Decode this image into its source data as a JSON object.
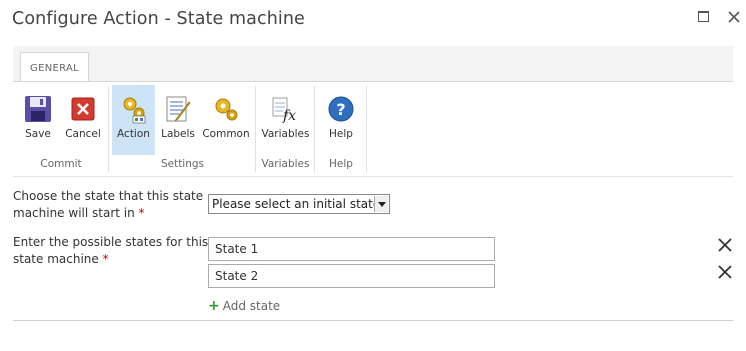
{
  "window": {
    "title": "Configure Action - State machine",
    "icons": {
      "maximize": "maximize-icon",
      "close": "close-icon"
    }
  },
  "ribbon": {
    "tab_label": "GENERAL",
    "groups": [
      {
        "label": "Commit",
        "buttons": [
          {
            "label": "Save",
            "icon": "save-icon"
          },
          {
            "label": "Cancel",
            "icon": "cancel-icon"
          }
        ]
      },
      {
        "label": "Settings",
        "buttons": [
          {
            "label": "Action",
            "icon": "action-gears-icon",
            "selected": true
          },
          {
            "label": "Labels",
            "icon": "labels-icon"
          },
          {
            "label": "Common",
            "icon": "common-gears-icon"
          }
        ]
      },
      {
        "label": "Variables",
        "buttons": [
          {
            "label": "Variables",
            "icon": "variables-fx-icon"
          }
        ]
      },
      {
        "label": "Help",
        "buttons": [
          {
            "label": "Help",
            "icon": "help-icon"
          }
        ]
      }
    ]
  },
  "form": {
    "initial_state": {
      "label": "Choose the state that this state machine will start in",
      "required_mark": "*",
      "selected_value": "Please select an initial state"
    },
    "states": {
      "label": "Enter the possible states for this state machine",
      "required_mark": "*",
      "items": [
        {
          "value": "State 1"
        },
        {
          "value": "State 2"
        }
      ],
      "add_label": "Add state"
    }
  }
}
